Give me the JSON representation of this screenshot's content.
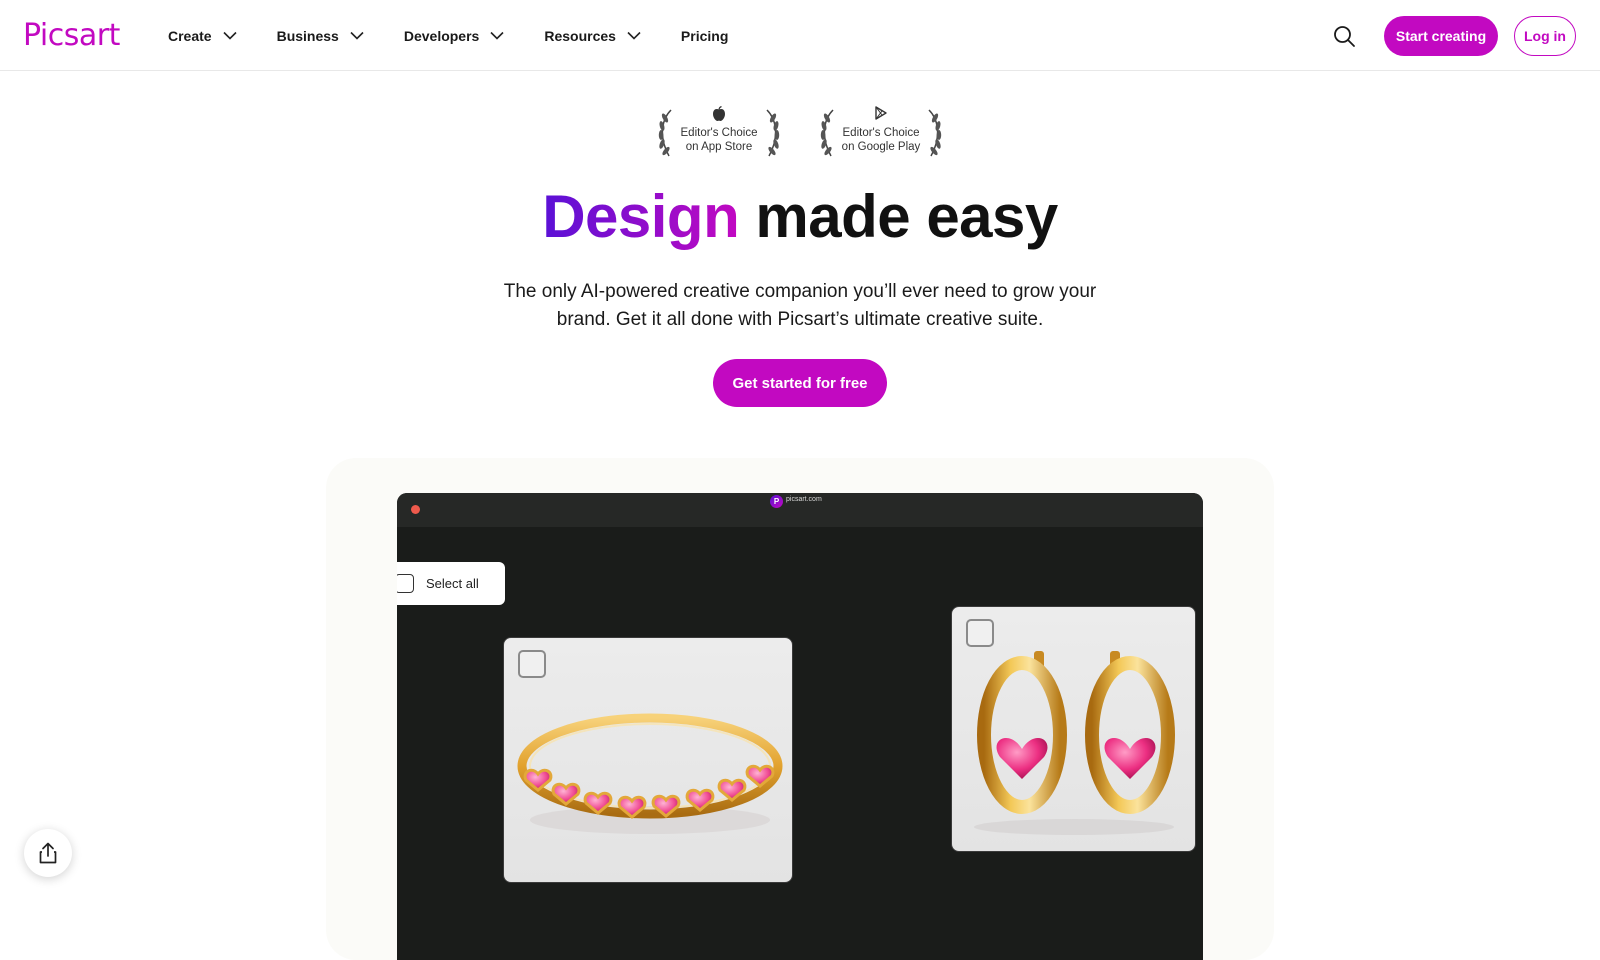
{
  "brand": {
    "logo": "Picsart",
    "accent": "#c209c1",
    "gradient_start": "#5a11d6"
  },
  "nav": {
    "items": [
      {
        "label": "Create",
        "icon": "chevron-down-icon"
      },
      {
        "label": "Business",
        "icon": "chevron-down-icon"
      },
      {
        "label": "Developers",
        "icon": "chevron-down-icon"
      },
      {
        "label": "Resources",
        "icon": "chevron-down-icon"
      },
      {
        "label": "Pricing"
      }
    ],
    "search_icon": "search-icon",
    "start_label": "Start creating",
    "login_label": "Log in"
  },
  "awards": [
    {
      "line1": "Editor's Choice",
      "line2": "on App Store",
      "icon": "apple-icon"
    },
    {
      "line1": "Editor's Choice",
      "line2": "on Google Play",
      "icon": "google-play-icon"
    }
  ],
  "hero": {
    "title_highlight": "Design",
    "title_rest": " made easy",
    "subtitle": "The only AI-powered creative companion you’ll ever need to grow your brand. Get it all done with Picsart’s ultimate creative suite.",
    "cta_label": "Get started for free"
  },
  "showcase": {
    "url": "picsart.com",
    "badge": "P",
    "select_all_label": "Select all",
    "cards": [
      {
        "name": "ring",
        "icon": "heart-ring-image"
      },
      {
        "name": "earrings",
        "icon": "heart-hoop-earrings-image"
      }
    ]
  },
  "share_icon": "share-icon"
}
